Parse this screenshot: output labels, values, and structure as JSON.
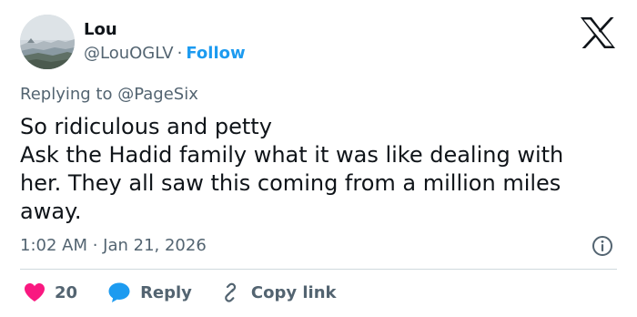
{
  "user": {
    "display_name": "Lou",
    "handle": "@LouOGLV",
    "separator": "·",
    "follow_label": "Follow",
    "avatar_icon": "landscape-photo-avatar"
  },
  "header": {
    "logo_icon": "x-logo-icon"
  },
  "reply_context": {
    "prefix": "Replying to",
    "mention": "@PageSix"
  },
  "tweet": {
    "lines": [
      "So ridiculous and petty",
      "Ask the Hadid family what it was like dealing with",
      "her. They all saw this coming from a million miles",
      "away."
    ],
    "timestamp": "1:02 AM · Jan 21, 2026"
  },
  "actions": {
    "like_count": "20",
    "reply_label": "Reply",
    "copy_link_label": "Copy link"
  },
  "colors": {
    "accent": "#1d9bf0",
    "like": "#f91880",
    "text": "#0f1419",
    "muted": "#536471",
    "divider": "#cfd9de"
  }
}
